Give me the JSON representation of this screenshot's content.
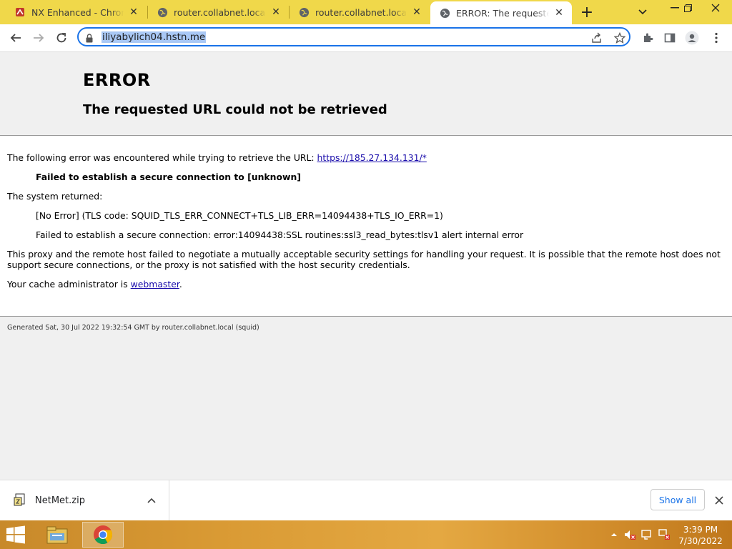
{
  "browser": {
    "tabs": [
      {
        "title": "NX Enhanced - Chrome W",
        "favicon": "nx-enhanced-icon",
        "active": false
      },
      {
        "title": "router.collabnet.local/blo",
        "favicon": "globe-icon",
        "active": false
      },
      {
        "title": "router.collabnet.local/blo",
        "favicon": "globe-icon",
        "active": false
      },
      {
        "title": "ERROR: The requested UR",
        "favicon": "globe-icon",
        "active": true
      }
    ],
    "address_bar": {
      "url": "iliyabylich04.hstn.me"
    }
  },
  "page": {
    "heading": "ERROR",
    "subheading": "The requested URL could not be retrieved",
    "intro_text": "The following error was encountered while trying to retrieve the URL:",
    "intro_link": "https://185.27.134.131/*",
    "error_summary": "Failed to establish a secure connection to [unknown]",
    "system_returned_label": "The system returned:",
    "system_detail_1": "[No Error] (TLS code: SQUID_TLS_ERR_CONNECT+TLS_LIB_ERR=14094438+TLS_IO_ERR=1)",
    "system_detail_2": "Failed to establish a secure connection: error:14094438:SSL routines:ssl3_read_bytes:tlsv1 alert internal error",
    "explanation_line_1": "This proxy and the remote host failed to negotiate a mutually acceptable security settings for handling your request. It is possible that the remote host does not",
    "explanation_line_2": "support secure connections, or the proxy is not satisfied with the host security credentials.",
    "admin_text": "Your cache administrator is",
    "admin_link": "webmaster",
    "admin_suffix": ".",
    "footer": "Generated Sat, 30 Jul 2022 19:32:54 GMT by router.collabnet.local (squid)"
  },
  "download_bar": {
    "file_name": "NetMet.zip",
    "show_all_label": "Show all"
  },
  "taskbar": {
    "time": "3:39 PM",
    "date": "7/30/2022"
  },
  "colors": {
    "tab_strip": "#f0d84a",
    "omnibox_focus": "#1a73e8",
    "link": "#1a0dab",
    "taskbar": "#d99a34"
  }
}
